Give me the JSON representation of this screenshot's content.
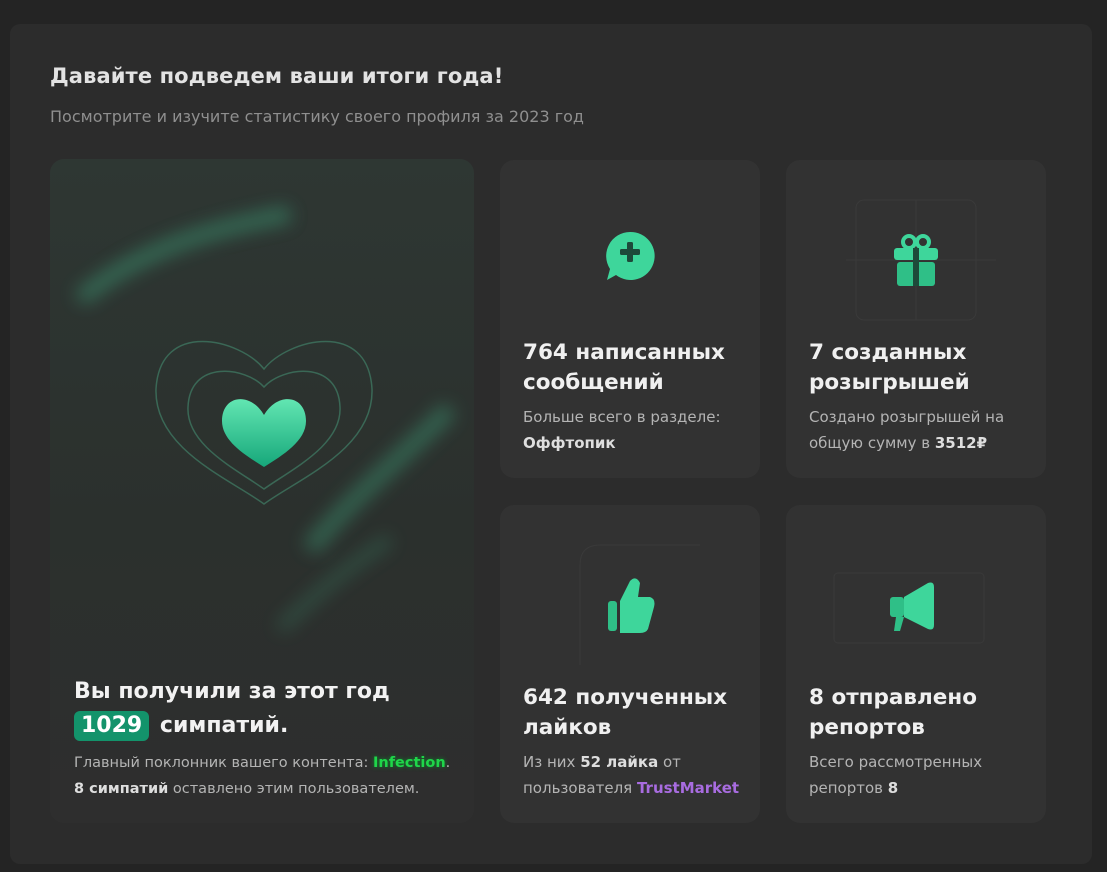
{
  "header": {
    "title": "Давайте подведем ваши итоги года!",
    "subtitle": "Посмотрите и изучите статистику своего профиля за 2023 год"
  },
  "likes_card": {
    "icon": "heart-icon",
    "headline_prefix": "Вы получили за этот год",
    "count": "1029",
    "headline_suffix": "симпатий.",
    "fan_label": "Главный поклонник вашего контента:",
    "fan_user": "Infection",
    "fan_dot": ".",
    "fan_likes": "8 симпатий",
    "fan_likes_suffix": "оставлено этим пользователем.",
    "accent_color": "#13936b"
  },
  "messages_card": {
    "icon": "chat-plus-icon",
    "title": "764 написанных сообщений",
    "desc_prefix": "Больше всего в разделе:",
    "section": "Оффтопик"
  },
  "giveaways_card": {
    "icon": "gift-icon",
    "title": "7 созданных розыгрышей",
    "desc_prefix": "Создано розыгрышей на общую сумму в",
    "amount": "3512₽"
  },
  "received_likes_card": {
    "icon": "thumbs-up-icon",
    "title": "642 полученных лайков",
    "desc_prefix": "Из них",
    "count": "52 лайка",
    "desc_mid": "от пользователя",
    "user": "TrustMarket",
    "user_color": "#a86ce0"
  },
  "reports_card": {
    "icon": "megaphone-icon",
    "title": "8 отправлено репортов",
    "desc_prefix": "Всего рассмотренных репортов",
    "count": "8"
  }
}
